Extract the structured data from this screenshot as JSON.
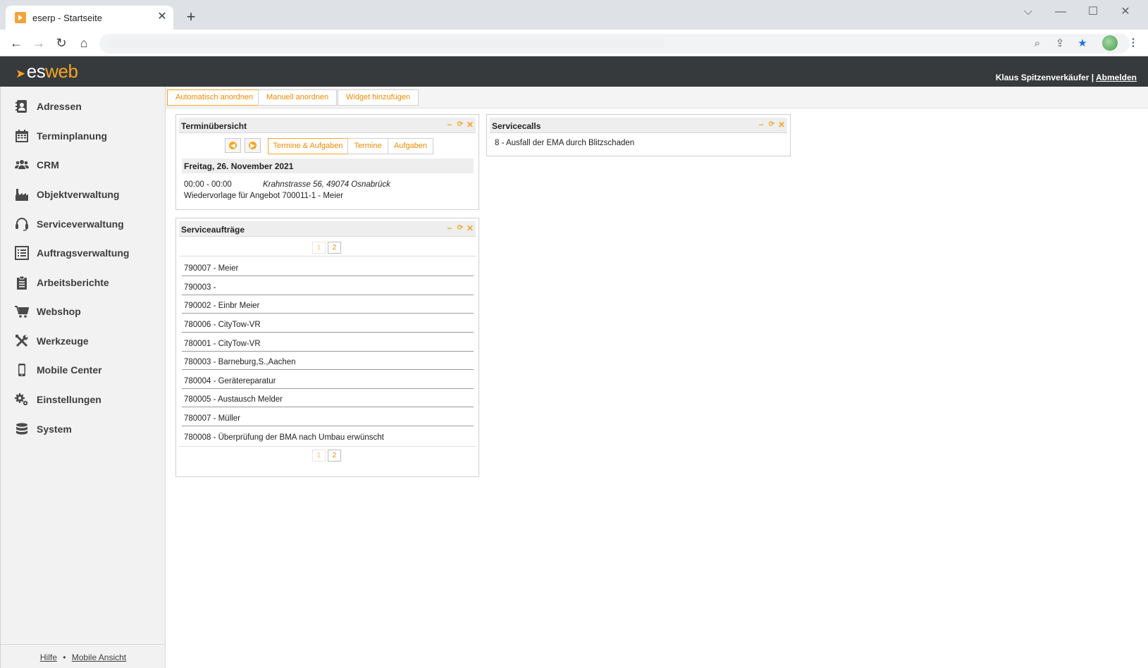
{
  "browser": {
    "tab_title": "eserp - Startseite",
    "tab_close": "✕",
    "new_tab": "+",
    "window_controls": [
      "⌵",
      "—",
      "☐",
      "✕"
    ]
  },
  "header": {
    "logo_es": "es",
    "logo_web": "web",
    "user_name": "Klaus Spitzenverkäufer |",
    "logout": "Abmelden"
  },
  "sidebar": {
    "items": [
      {
        "label": "Adressen",
        "icon": "address-book-icon"
      },
      {
        "label": "Terminplanung",
        "icon": "calendar-icon"
      },
      {
        "label": "CRM",
        "icon": "users-icon"
      },
      {
        "label": "Objektverwaltung",
        "icon": "factory-icon"
      },
      {
        "label": "Serviceverwaltung",
        "icon": "headset-icon"
      },
      {
        "label": "Auftragsverwaltung",
        "icon": "list-icon"
      },
      {
        "label": "Arbeitsberichte",
        "icon": "clipboard-icon"
      },
      {
        "label": "Webshop",
        "icon": "cart-icon"
      },
      {
        "label": "Werkzeuge",
        "icon": "tools-icon"
      },
      {
        "label": "Mobile Center",
        "icon": "mobile-icon"
      },
      {
        "label": "Einstellungen",
        "icon": "gears-icon"
      },
      {
        "label": "System",
        "icon": "database-icon"
      }
    ],
    "footer_help": "Hilfe",
    "footer_sep": "•",
    "footer_mobile": "Mobile Ansicht"
  },
  "actions": {
    "auto_arrange": "Automatisch anordnen",
    "manual_arrange": "Manuell anordnen",
    "add_widget": "Widget hinzufügen"
  },
  "widget_controls": {
    "minimize": "−",
    "refresh": "⟳",
    "close": "✕"
  },
  "termin": {
    "title": "Terminübersicht",
    "tab_all": "Termine & Aufgaben",
    "tab_termine": "Termine",
    "tab_aufgaben": "Aufgaben",
    "date": "Freitag, 26. November 2021",
    "appointment": {
      "time": "00:00 - 00:00",
      "address": "Krahnstrasse 56, 49074 Osnabrück",
      "text": "Wiedervorlage für Angebot 700011-1 - Meier"
    }
  },
  "servicecalls": {
    "title": "Servicecalls",
    "items": [
      "8 - Ausfall der EMA durch Blitzschaden"
    ]
  },
  "serviceauftraege": {
    "title": "Serviceaufträge",
    "pages": [
      "1",
      "2"
    ],
    "current_page": "2",
    "rows": [
      "790007 - Meier",
      "790003 -",
      "790002 - Einbr Meier",
      "780006 - CityTow-VR",
      "780001 - CityTow-VR",
      "780003 - Barneburg,S.,Aachen",
      "780004 - Gerätereparatur",
      "780005 - Austausch Melder",
      "780007 - Müller",
      "780008 - Überprüfung der BMA nach Umbau erwünscht"
    ]
  },
  "colors": {
    "accent": "#f5a623",
    "header_bg": "#373a3c"
  }
}
